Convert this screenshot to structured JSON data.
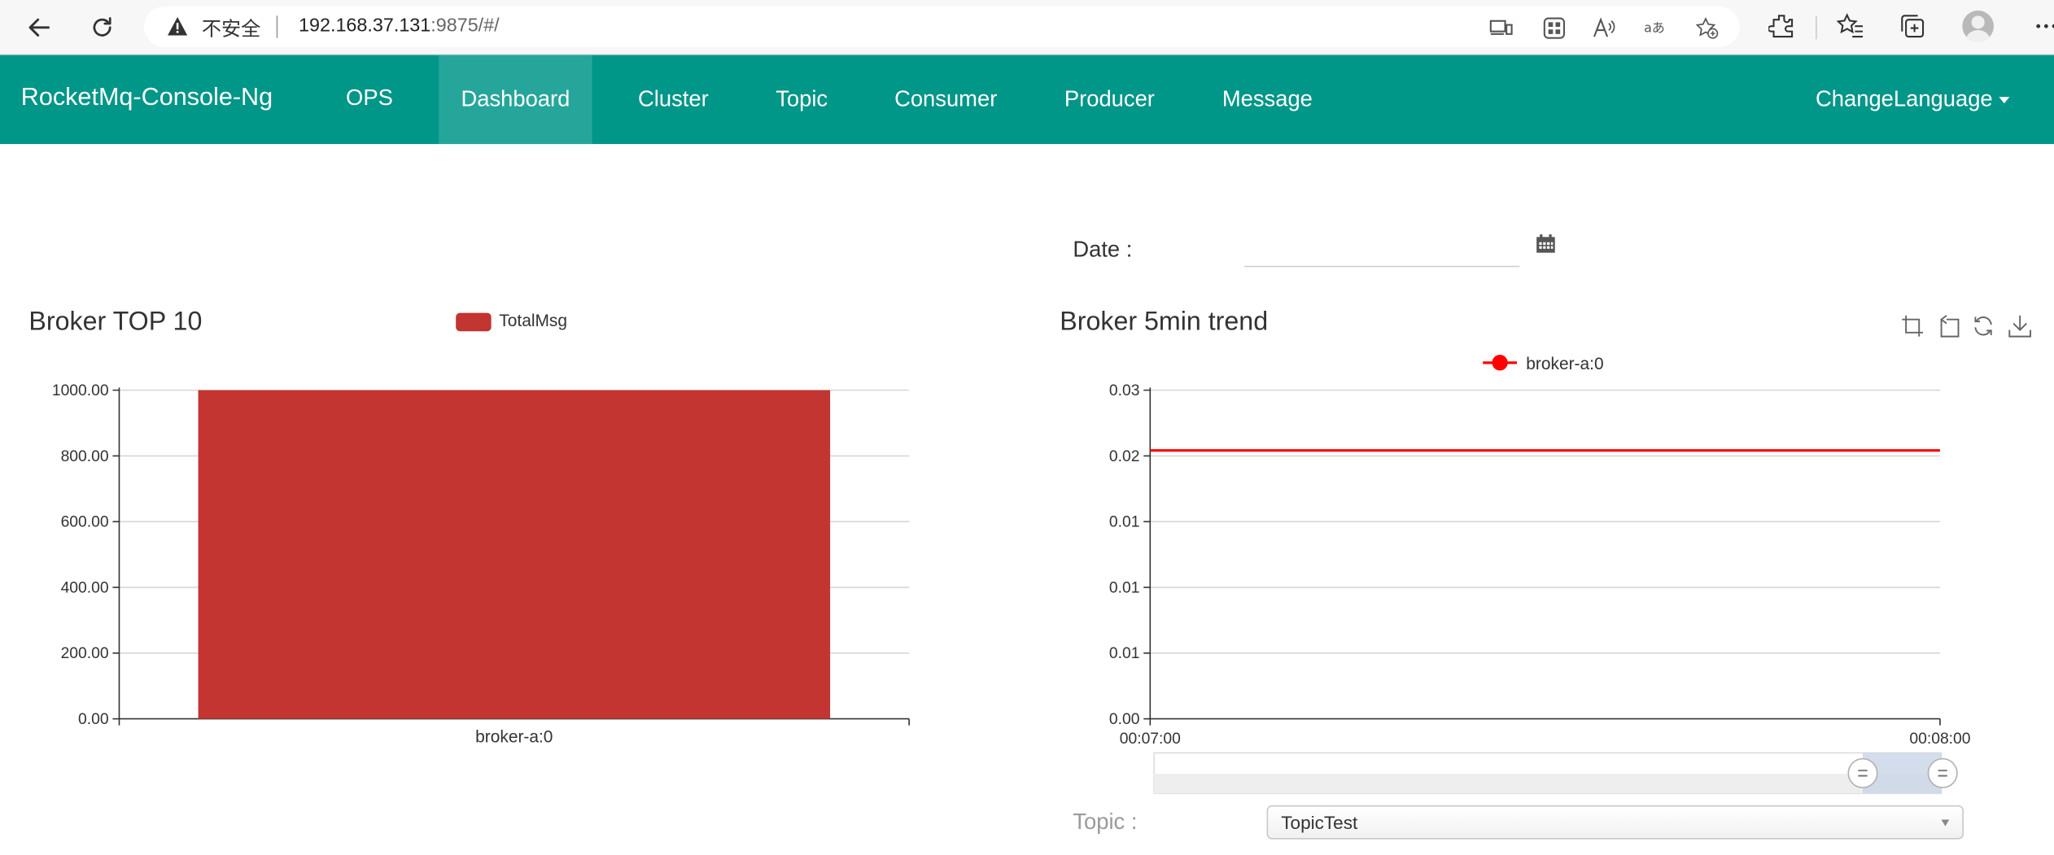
{
  "browser": {
    "security_text": "不安全",
    "url_host": "192.168.37.131",
    "url_rest": ":9875/#/"
  },
  "navbar": {
    "brand": "RocketMq-Console-Ng",
    "items": [
      {
        "label": "OPS"
      },
      {
        "label": "Dashboard"
      },
      {
        "label": "Cluster"
      },
      {
        "label": "Topic"
      },
      {
        "label": "Consumer"
      },
      {
        "label": "Producer"
      },
      {
        "label": "Message"
      }
    ],
    "active": "Dashboard",
    "change_language": "ChangeLanguage",
    "color": "#009688",
    "active_color": "#26a69a"
  },
  "date_filter": {
    "label": "Date :",
    "value": ""
  },
  "broker_top": {
    "title": "Broker TOP 10",
    "legend": "TotalMsg"
  },
  "broker_trend": {
    "title": "Broker 5min trend",
    "legend": "broker-a:0"
  },
  "topic_filter": {
    "label": "Topic :",
    "selected": "TopicTest"
  },
  "chart_data": [
    {
      "type": "bar",
      "title": "Broker TOP 10",
      "categories": [
        "broker-a:0"
      ],
      "series": [
        {
          "name": "TotalMsg",
          "values": [
            1000
          ],
          "color": "#c23531"
        }
      ],
      "ylim": [
        0,
        1000
      ],
      "yticks": [
        "0.00",
        "200.00",
        "400.00",
        "600.00",
        "800.00",
        "1000.00"
      ],
      "ytick_values": [
        0,
        200,
        400,
        600,
        800,
        1000
      ],
      "grid": true,
      "legend": "top-center"
    },
    {
      "type": "line",
      "title": "Broker 5min trend",
      "x": [
        "00:07:00",
        "00:08:00"
      ],
      "xticks": [
        "00:07:00",
        "00:08:00"
      ],
      "series": [
        {
          "name": "broker-a:0",
          "values": [
            0.0245,
            0.0245
          ],
          "color": "#ff0000"
        }
      ],
      "ylim": [
        0,
        0.03
      ],
      "yticks": [
        "0.00",
        "0.01",
        "0.01",
        "0.01",
        "0.02",
        "0.03"
      ],
      "ytick_values": [
        0,
        0.006,
        0.012,
        0.018,
        0.024,
        0.03
      ],
      "grid": true,
      "legend": "top-center",
      "dataZoom": true
    }
  ]
}
